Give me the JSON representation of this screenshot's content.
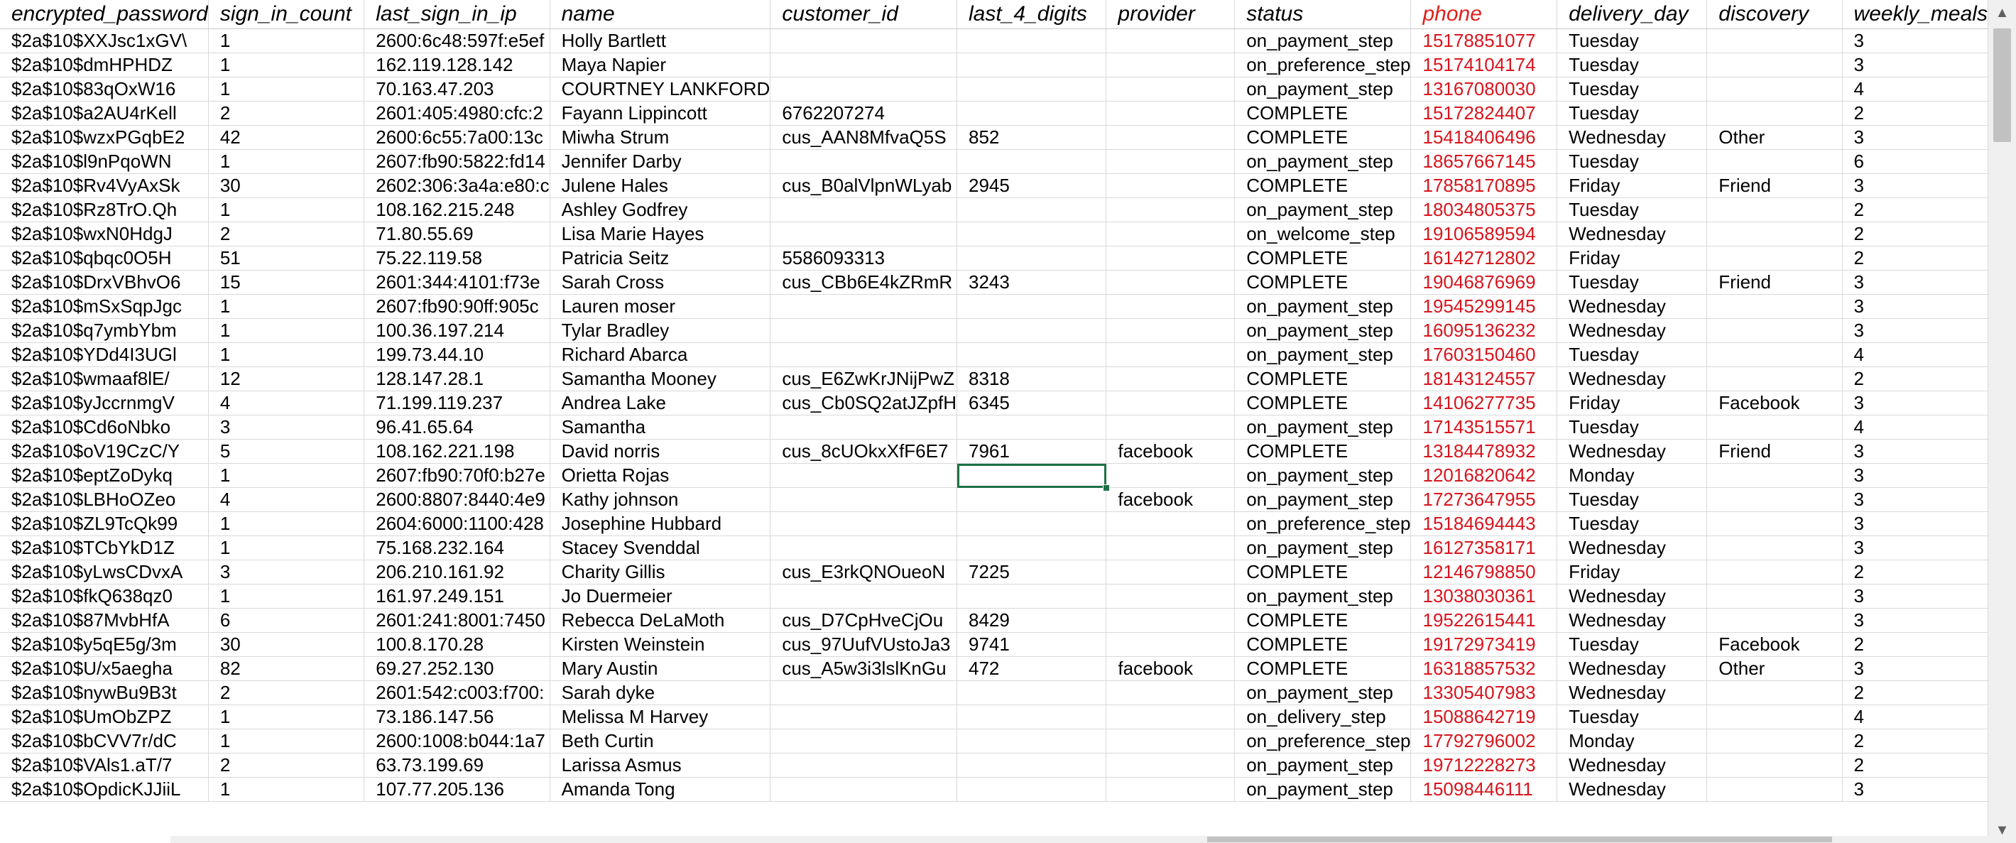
{
  "columns": [
    "encrypted_password",
    "sign_in_count",
    "last_sign_in_ip",
    "name",
    "customer_id",
    "last_4_digits",
    "provider",
    "status",
    "phone",
    "delivery_day",
    "discovery",
    "weekly_meals"
  ],
  "rows": [
    [
      "$2a$10$XXJsc1xGV\\",
      "1",
      "2600:6c48:597f:e5ef",
      "Holly Bartlett",
      "",
      "",
      "",
      "on_payment_step",
      "15178851077",
      "Tuesday",
      "",
      "3"
    ],
    [
      "$2a$10$dmHPHDZ",
      "1",
      "162.119.128.142",
      "Maya Napier",
      "",
      "",
      "",
      "on_preference_step",
      "15174104174",
      "Tuesday",
      "",
      "3"
    ],
    [
      "$2a$10$83qOxW16",
      "1",
      "70.163.47.203",
      "COURTNEY LANKFORD",
      "",
      "",
      "",
      "on_payment_step",
      "13167080030",
      "Tuesday",
      "",
      "4"
    ],
    [
      "$2a$10$a2AU4rKell",
      "2",
      "2601:405:4980:cfc:2",
      "Fayann Lippincott",
      "6762207274",
      "",
      "",
      "COMPLETE",
      "15172824407",
      "Tuesday",
      "",
      "2"
    ],
    [
      "$2a$10$wzxPGqbE2",
      "42",
      "2600:6c55:7a00:13c",
      "Miwha Strum",
      "cus_AAN8MfvaQ5S",
      "852",
      "",
      "COMPLETE",
      "15418406496",
      "Wednesday",
      "Other",
      "3"
    ],
    [
      "$2a$10$l9nPqoWN",
      "1",
      "2607:fb90:5822:fd14",
      "Jennifer Darby",
      "",
      "",
      "",
      "on_payment_step",
      "18657667145",
      "Tuesday",
      "",
      "6"
    ],
    [
      "$2a$10$Rv4VyAxSk",
      "30",
      "2602:306:3a4a:e80:c",
      "Julene Hales",
      "cus_B0alVlpnWLyab",
      "2945",
      "",
      "COMPLETE",
      "17858170895",
      "Friday",
      "Friend",
      "3"
    ],
    [
      "$2a$10$Rz8TrO.Qh",
      "1",
      "108.162.215.248",
      "Ashley Godfrey",
      "",
      "",
      "",
      "on_payment_step",
      "18034805375",
      "Tuesday",
      "",
      "2"
    ],
    [
      "$2a$10$wxN0HdgJ",
      "2",
      "71.80.55.69",
      "Lisa Marie Hayes",
      "",
      "",
      "",
      "on_welcome_step",
      "19106589594",
      "Wednesday",
      "",
      "2"
    ],
    [
      "$2a$10$qbqc0O5H",
      "51",
      "75.22.119.58",
      "Patricia Seitz",
      "5586093313",
      "",
      "",
      "COMPLETE",
      "16142712802",
      "Friday",
      "",
      "2"
    ],
    [
      "$2a$10$DrxVBhvO6",
      "15",
      "2601:344:4101:f73e",
      "Sarah Cross",
      "cus_CBb6E4kZRmR",
      "3243",
      "",
      "COMPLETE",
      "19046876969",
      "Tuesday",
      "Friend",
      "3"
    ],
    [
      "$2a$10$mSxSqpJgc",
      "1",
      "2607:fb90:90ff:905c",
      "Lauren moser",
      "",
      "",
      "",
      "on_payment_step",
      "19545299145",
      "Wednesday",
      "",
      "3"
    ],
    [
      "$2a$10$q7ymbYbm",
      "1",
      "100.36.197.214",
      "Tylar Bradley",
      "",
      "",
      "",
      "on_payment_step",
      "16095136232",
      "Wednesday",
      "",
      "3"
    ],
    [
      "$2a$10$YDd4I3UGl",
      "1",
      "199.73.44.10",
      "Richard Abarca",
      "",
      "",
      "",
      "on_payment_step",
      "17603150460",
      "Tuesday",
      "",
      "4"
    ],
    [
      "$2a$10$wmaaf8lE/",
      "12",
      "128.147.28.1",
      "Samantha Mooney",
      "cus_E6ZwKrJNijPwZ",
      "8318",
      "",
      "COMPLETE",
      "18143124557",
      "Wednesday",
      "",
      "2"
    ],
    [
      "$2a$10$yJccrnmgV",
      "4",
      "71.199.119.237",
      "Andrea Lake",
      "cus_Cb0SQ2atJZpfH",
      "6345",
      "",
      "COMPLETE",
      "14106277735",
      "Friday",
      "Facebook",
      "3"
    ],
    [
      "$2a$10$Cd6oNbko",
      "3",
      "96.41.65.64",
      "Samantha",
      "",
      "",
      "",
      "on_payment_step",
      "17143515571",
      "Tuesday",
      "",
      "4"
    ],
    [
      "$2a$10$oV19CzC/Y",
      "5",
      "108.162.221.198",
      "David norris",
      "cus_8cUOkxXfF6E7",
      "7961",
      "facebook",
      "COMPLETE",
      "13184478932",
      "Wednesday",
      "Friend",
      "3"
    ],
    [
      "$2a$10$eptZoDykq",
      "1",
      "2607:fb90:70f0:b27e",
      "Orietta Rojas",
      "",
      "",
      "",
      "on_payment_step",
      "12016820642",
      "Monday",
      "",
      "3"
    ],
    [
      "$2a$10$LBHoOZeo",
      "4",
      "2600:8807:8440:4e9",
      "Kathy johnson",
      "",
      "",
      "facebook",
      "on_payment_step",
      "17273647955",
      "Tuesday",
      "",
      "3"
    ],
    [
      "$2a$10$ZL9TcQk99",
      "1",
      "2604:6000:1100:428",
      "Josephine Hubbard",
      "",
      "",
      "",
      "on_preference_step",
      "15184694443",
      "Tuesday",
      "",
      "3"
    ],
    [
      "$2a$10$TCbYkD1Z",
      "1",
      "75.168.232.164",
      "Stacey Svenddal",
      "",
      "",
      "",
      "on_payment_step",
      "16127358171",
      "Wednesday",
      "",
      "3"
    ],
    [
      "$2a$10$yLwsCDvxA",
      "3",
      "206.210.161.92",
      "Charity Gillis",
      "cus_E3rkQNOueoN",
      "7225",
      "",
      "COMPLETE",
      "12146798850",
      "Friday",
      "",
      "2"
    ],
    [
      "$2a$10$fkQ638qz0",
      "1",
      "161.97.249.151",
      "Jo Duermeier",
      "",
      "",
      "",
      "on_payment_step",
      "13038030361",
      "Wednesday",
      "",
      "3"
    ],
    [
      "$2a$10$87MvbHfA",
      "6",
      "2601:241:8001:7450",
      "Rebecca DeLaMoth",
      "cus_D7CpHveCjOu",
      "8429",
      "",
      "COMPLETE",
      "19522615441",
      "Wednesday",
      "",
      "3"
    ],
    [
      "$2a$10$y5qE5g/3m",
      "30",
      "100.8.170.28",
      "Kirsten Weinstein",
      "cus_97UufVUstoJa3",
      "9741",
      "",
      "COMPLETE",
      "19172973419",
      "Tuesday",
      "Facebook",
      "2"
    ],
    [
      "$2a$10$U/x5aegha",
      "82",
      "69.27.252.130",
      "Mary Austin",
      "cus_A5w3i3lslKnGu",
      "472",
      "facebook",
      "COMPLETE",
      "16318857532",
      "Wednesday",
      "Other",
      "3"
    ],
    [
      "$2a$10$nywBu9B3t",
      "2",
      "2601:542:c003:f700:",
      "Sarah dyke",
      "",
      "",
      "",
      "on_payment_step",
      "13305407983",
      "Wednesday",
      "",
      "2"
    ],
    [
      "$2a$10$UmObZPZ",
      "1",
      "73.186.147.56",
      "Melissa M Harvey",
      "",
      "",
      "",
      "on_delivery_step",
      "15088642719",
      "Tuesday",
      "",
      "4"
    ],
    [
      "$2a$10$bCVV7r/dC",
      "1",
      "2600:1008:b044:1a7",
      "Beth Curtin",
      "",
      "",
      "",
      "on_preference_step",
      "17792796002",
      "Monday",
      "",
      "2"
    ],
    [
      "$2a$10$VAls1.aT/7",
      "2",
      "63.73.199.69",
      "Larissa Asmus",
      "",
      "",
      "",
      "on_payment_step",
      "19712228273",
      "Wednesday",
      "",
      "2"
    ],
    [
      "$2a$10$OpdicKJJiiL",
      "1",
      "107.77.205.136",
      "Amanda Tong",
      "",
      "",
      "",
      "on_payment_step",
      "15098446111",
      "Wednesday",
      "",
      "3"
    ]
  ],
  "selected_cell": {
    "row": 18,
    "column": "last_4_digits"
  },
  "colors": {
    "accent": "#1e7145",
    "phone_text": "#d8141d",
    "grid_line": "#d9d9d9"
  },
  "icons": {
    "scroll_up": "triangle-up",
    "scroll_down": "triangle-down"
  }
}
